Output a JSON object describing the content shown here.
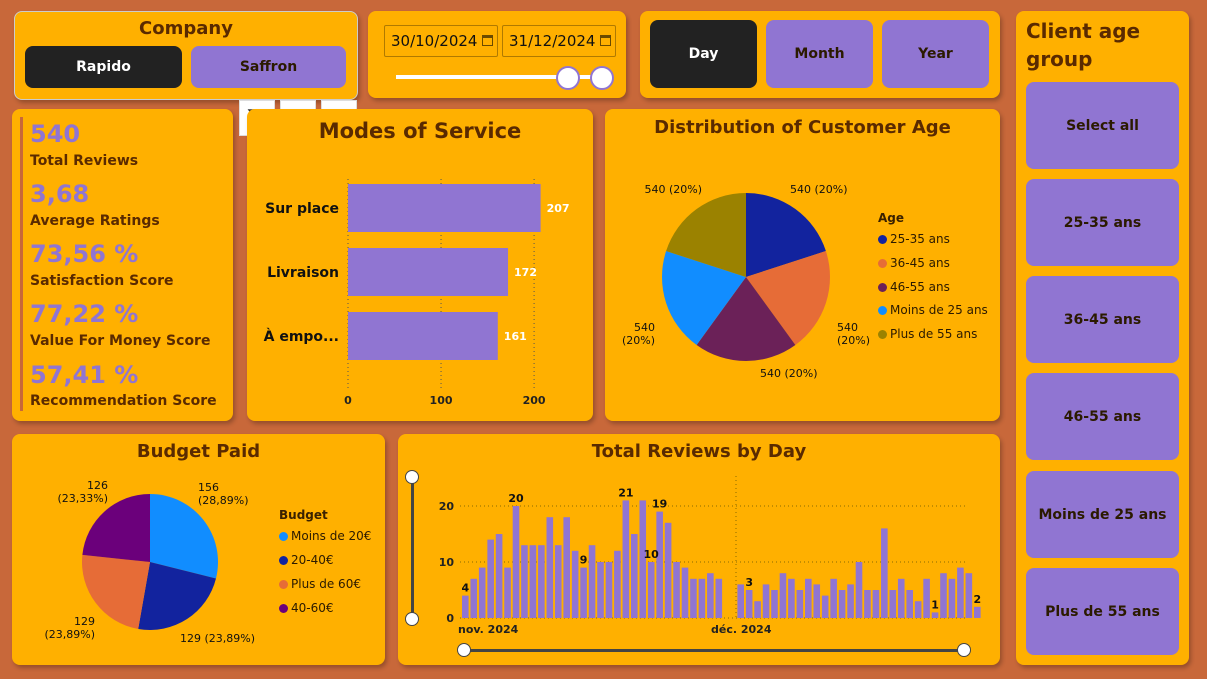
{
  "company": {
    "title": "Company",
    "options": [
      "Rapido",
      "Saffron"
    ]
  },
  "dates": {
    "start": "30/10/2024",
    "end": "31/12/2024"
  },
  "granularity": [
    "Day",
    "Month",
    "Year"
  ],
  "kpis": [
    {
      "value": "540",
      "label": "Total Reviews"
    },
    {
      "value": "3,68",
      "label": "Average Ratings"
    },
    {
      "value": "73,56 %",
      "label": "Satisfaction Score"
    },
    {
      "value": "77,22 %",
      "label": "Value For Money Score"
    },
    {
      "value": "57,41 %",
      "label": "Recommendation Score"
    }
  ],
  "age_slicer": {
    "title": "Client age group",
    "options": [
      "Select all",
      "25-35 ans",
      "36-45 ans",
      "46-55 ans",
      "Moins de 25 ans",
      "Plus de 55 ans"
    ]
  },
  "colors": {
    "background": "#C8683A",
    "card": "#FFB000",
    "accent": "#9075D2",
    "dark": "#222222"
  },
  "chart_data": [
    {
      "type": "bar",
      "title": "Modes of Service",
      "categories": [
        "Sur place",
        "Livraison",
        "À empo..."
      ],
      "values": [
        207,
        172,
        161
      ],
      "xticks": [
        "0",
        "100",
        "200"
      ],
      "xlim": [
        0,
        230
      ],
      "color": "#9075D2"
    },
    {
      "type": "pie",
      "title": "Distribution of Customer Age",
      "legend_title": "Age",
      "labels": [
        "25-35 ans",
        "36-45 ans",
        "46-55 ans",
        "Moins de 25 ans",
        "Plus de 55 ans"
      ],
      "values": [
        540,
        540,
        540,
        540,
        540
      ],
      "data_labels": [
        "540 (20%)",
        "540 (20%)",
        "540 (20%)",
        "540 (20%)",
        "540 (20%)"
      ],
      "colors": [
        "#12239E",
        "#E66C37",
        "#6B2158",
        "#118DFF",
        "#9B8200"
      ]
    },
    {
      "type": "pie",
      "title": "Budget Paid",
      "legend_title": "Budget",
      "labels": [
        "Moins de 20€",
        "20-40€",
        "Plus de 60€",
        "40-60€"
      ],
      "values": [
        156,
        129,
        129,
        126
      ],
      "data_labels": [
        "156 (28,89%)",
        "129 (23,89%)",
        "129 (23,89%)",
        "126 (23,33%)"
      ],
      "colors": [
        "#118DFF",
        "#12239E",
        "#E66C37",
        "#6B007B"
      ]
    },
    {
      "type": "bar",
      "title": "Total Reviews by Day",
      "x_labels": [
        "nov. 2024",
        "déc. 2024"
      ],
      "yticks": [
        "0",
        "10",
        "20"
      ],
      "ylim": [
        0,
        24
      ],
      "values": [
        4,
        7,
        9,
        14,
        15,
        9,
        20,
        13,
        13,
        13,
        18,
        13,
        18,
        12,
        9,
        13,
        10,
        10,
        12,
        21,
        15,
        21,
        10,
        19,
        17,
        10,
        9,
        7,
        7,
        8,
        7,
        0,
        6,
        5,
        3,
        6,
        5,
        8,
        7,
        5,
        7,
        6,
        4,
        7,
        5,
        6,
        10,
        5,
        5,
        16,
        5,
        7,
        5,
        3,
        7,
        1,
        8,
        7,
        9,
        8,
        2
      ],
      "value_labels": [
        {
          "i": 0,
          "t": "4"
        },
        {
          "i": 6,
          "t": "20"
        },
        {
          "i": 14,
          "t": "9"
        },
        {
          "i": 19,
          "t": "21"
        },
        {
          "i": 22,
          "t": "10"
        },
        {
          "i": 23,
          "t": "19"
        },
        {
          "i": 33,
          "t": "3"
        },
        {
          "i": 55,
          "t": "1"
        },
        {
          "i": 60,
          "t": "2"
        }
      ],
      "color": "#9075D2"
    }
  ]
}
